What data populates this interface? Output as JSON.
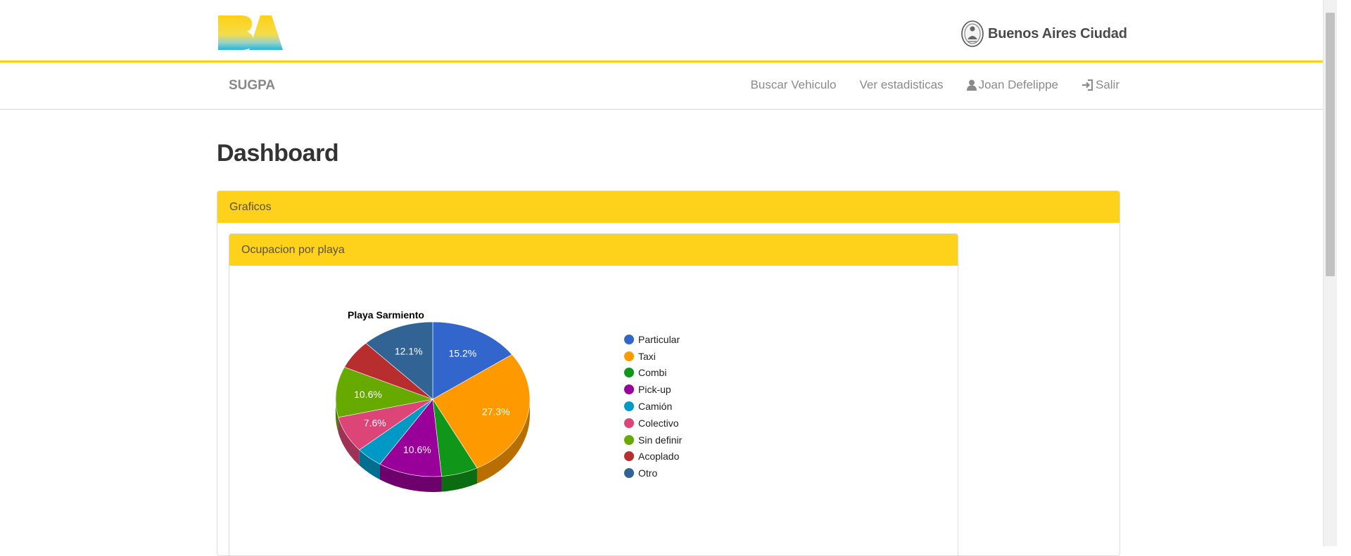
{
  "header": {
    "logo_text": "BA",
    "city_name": "Buenos Aires Ciudad"
  },
  "nav": {
    "brand": "SUGPA",
    "links": {
      "search": "Buscar Vehiculo",
      "stats": "Ver estadisticas",
      "user": "Joan Defelippe",
      "logout": "Salir"
    },
    "icons": {
      "user": "user-icon",
      "logout": "log-in-icon"
    }
  },
  "page": {
    "title": "Dashboard"
  },
  "panels": {
    "outer_title": "Graficos",
    "inner_title": "Ocupacion por playa"
  },
  "colors": {
    "accent": "#fed21b",
    "header_rule": "#fcd116"
  },
  "chart_data": {
    "type": "pie",
    "title": "Playa Sarmiento",
    "is_3d": true,
    "legend_position": "right",
    "categories": [
      "Particular",
      "Taxi",
      "Combi",
      "Pick-up",
      "Camión",
      "Colectivo",
      "Sin definir",
      "Acoplado",
      "Otro"
    ],
    "values": [
      15.2,
      27.3,
      6.1,
      10.6,
      4.5,
      7.6,
      10.6,
      6.1,
      12.1
    ],
    "labels": [
      "15.2%",
      "27.3%",
      "",
      "10.6%",
      "",
      "7.6%",
      "10.6%",
      "",
      "12.1%"
    ],
    "colors": [
      "#3366cc",
      "#ff9900",
      "#109618",
      "#990099",
      "#0099c6",
      "#dd4477",
      "#66aa00",
      "#b82e2e",
      "#316395"
    ]
  }
}
